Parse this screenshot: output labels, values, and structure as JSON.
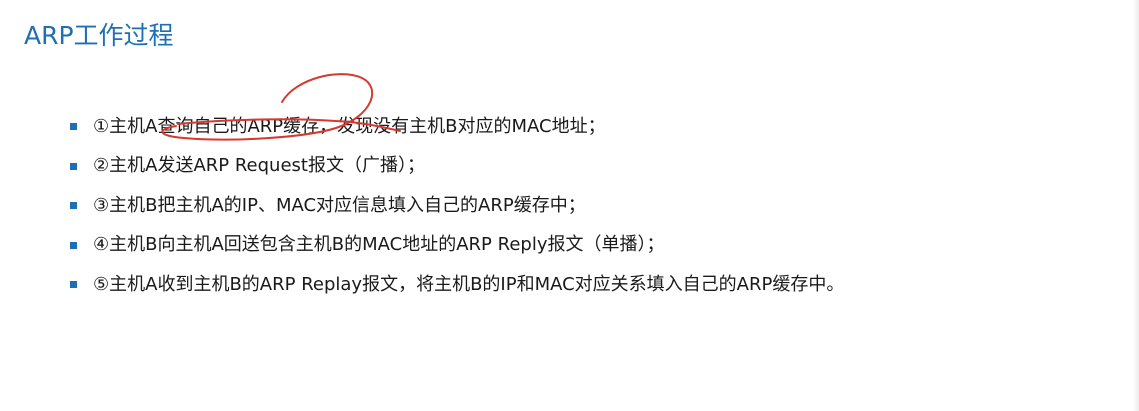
{
  "slide": {
    "title": "ARP工作过程",
    "bullets": [
      "①主机A查询自己的ARP缓存，发现没有主机B对应的MAC地址；",
      "②主机A发送ARP Request报文（广播）；",
      "③主机B把主机A的IP、MAC对应信息填入自己的ARP缓存中；",
      "④主机B向主机A回送包含主机B的MAC地址的ARP Reply报文（单播）；",
      "⑤主机A收到主机B的ARP Replay报文，将主机B的IP和MAC对应关系填入自己的ARP缓存中。"
    ]
  },
  "colors": {
    "accent": "#1f6fb5",
    "text": "#1a1a1a",
    "annotation": "#d43a2f"
  },
  "icons": {
    "bullet": "square-bullet-icon"
  }
}
